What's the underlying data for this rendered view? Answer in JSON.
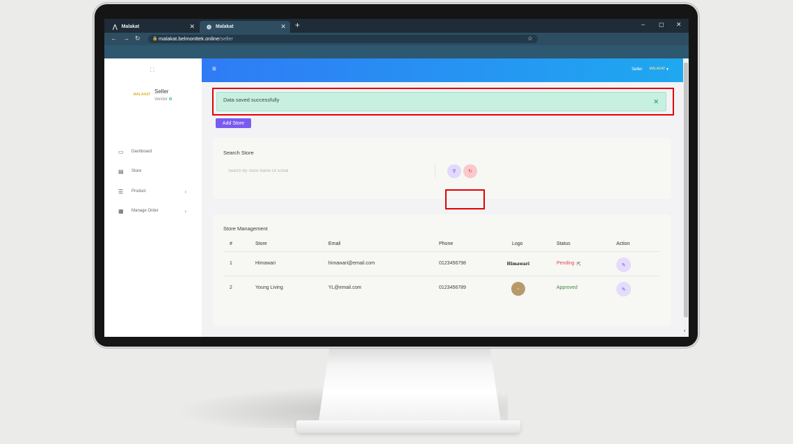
{
  "browser": {
    "tabs": [
      {
        "title": "Malakat",
        "icon": "⋀",
        "close": "✕"
      },
      {
        "title": "Malakat",
        "icon": "◍",
        "close": "✕"
      }
    ],
    "new_tab": "+",
    "window_controls": {
      "minimize": "–",
      "maximize": "◻",
      "close": "✕"
    },
    "nav": {
      "back": "←",
      "forward": "→",
      "reload": "↻"
    },
    "url_host": "malakat.belmonttek.online",
    "url_path": "/seller",
    "bookmark": "☆",
    "lock": "🔒"
  },
  "sidebar": {
    "logo": "⛶",
    "avatar_text": "MALAKAT",
    "user_name": "Seller",
    "user_role": "Vendor",
    "items": [
      {
        "label": "Dashboard",
        "icon": "▭",
        "chevron": ""
      },
      {
        "label": "Store",
        "icon": "▤",
        "chevron": ""
      },
      {
        "label": "Product",
        "icon": "☰",
        "chevron": "›"
      },
      {
        "label": "Manage Order",
        "icon": "▦",
        "chevron": "›"
      }
    ]
  },
  "header": {
    "menu_icon": "≡",
    "user_label": "Seller",
    "avatar_text": "MALAKAT",
    "caret": "▾"
  },
  "alert": {
    "message": "Data saved successfully",
    "close": "✕"
  },
  "add_store_label": "Add Store",
  "search": {
    "title": "Search Store",
    "placeholder": "Search By Store Name Or Email",
    "search_icon": "⚲",
    "reset_icon": "↻"
  },
  "table": {
    "title": "Store Management",
    "columns": [
      "#",
      "Store",
      "Email",
      "Phone",
      "Logo",
      "Status",
      "Action"
    ],
    "rows": [
      {
        "no": "1",
        "store": "Himawari",
        "email": "himawari@email.com",
        "phone": "0123456798",
        "logo": "Himawari",
        "status": "Pending",
        "action": "✎"
      },
      {
        "no": "2",
        "store": "Young Living",
        "email": "YL@email.com",
        "phone": "0123456789",
        "logo": "YL",
        "status": "Approved",
        "action": "✎"
      }
    ]
  },
  "colors": {
    "header_start": "#2f7bf5",
    "header_end": "#1fa8f0",
    "alert_bg": "#c7f0e0",
    "add_button": "#7a5af0",
    "status_pending": "#e04848",
    "status_approved": "#3e8a3e",
    "highlight_box": "#e10000"
  }
}
